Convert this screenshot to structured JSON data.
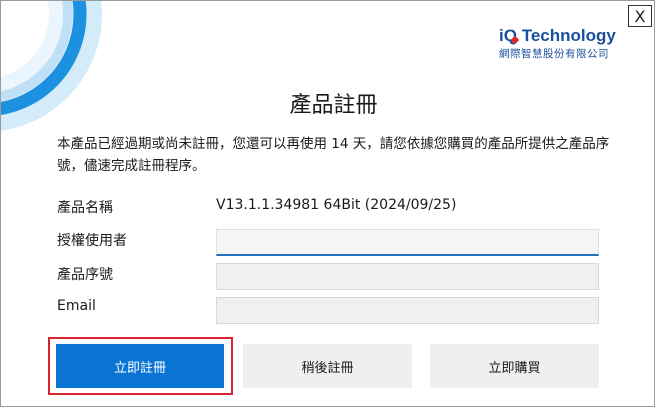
{
  "window": {
    "title": "產品註冊",
    "close_label": "X"
  },
  "logo": {
    "brand_i": "i",
    "brand_q": "Q",
    "brand_rest": " Technology",
    "subtitle": "網際智慧股份有限公司"
  },
  "description": "本產品已經過期或尚未註冊，您還可以再使用 14 天，請您依據您購買的產品所提供之產品序號，儘速完成註冊程序。",
  "form": {
    "product_name_label": "產品名稱",
    "product_name_value": "V13.1.1.34981 64Bit (2024/09/25)",
    "user_label": "授權使用者",
    "user_value": "",
    "serial_label": "產品序號",
    "serial_value": "",
    "email_label": "Email",
    "email_value": ""
  },
  "buttons": {
    "register_now": "立即註冊",
    "register_later": "稍後註冊",
    "buy_now": "立即購買"
  },
  "colors": {
    "primary_button": "#0a74d4",
    "highlight": "#d9232f",
    "logo_blue": "#1b4f9c",
    "logo_red": "#e0242a",
    "ring_blue": "#1e90e0"
  }
}
